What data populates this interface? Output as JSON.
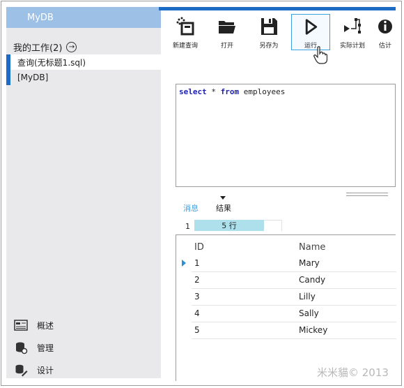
{
  "app": {
    "title": "MyDB"
  },
  "sidebar": {
    "section_label": "我的工作(2)",
    "items": [
      {
        "label": "查询(无标题1.sql)"
      },
      {
        "label": "[MyDB]"
      }
    ],
    "bottom_nav": [
      {
        "label": "概述",
        "icon": "overview-icon"
      },
      {
        "label": "管理",
        "icon": "database-admin-icon"
      },
      {
        "label": "设计",
        "icon": "design-icon"
      }
    ]
  },
  "toolbar": {
    "buttons": [
      {
        "label": "新建查询",
        "icon": "new-query-icon"
      },
      {
        "label": "打开",
        "icon": "open-folder-icon"
      },
      {
        "label": "另存为",
        "icon": "save-as-icon"
      },
      {
        "label": "运行",
        "icon": "run-icon",
        "selected": true
      },
      {
        "label": "实际计划",
        "icon": "actual-plan-icon"
      },
      {
        "label": "估计",
        "icon": "estimate-icon"
      }
    ]
  },
  "editor": {
    "tokens": [
      {
        "text": "select",
        "kw": true
      },
      {
        "text": " * ",
        "kw": false
      },
      {
        "text": "from",
        "kw": true
      },
      {
        "text": " employees",
        "kw": false
      }
    ]
  },
  "results": {
    "tabs": {
      "messages": "消息",
      "results": "结果"
    },
    "pager": {
      "page": "1",
      "rows_label": "5 行"
    },
    "columns": [
      "ID",
      "Name"
    ],
    "rows": [
      {
        "id": "1",
        "name": "Mary"
      },
      {
        "id": "2",
        "name": "Candy"
      },
      {
        "id": "3",
        "name": "Lilly"
      },
      {
        "id": "4",
        "name": "Sally"
      },
      {
        "id": "5",
        "name": "Mickey"
      }
    ]
  },
  "watermark": "米米貓© 2013",
  "colors": {
    "accent": "#1c6cc6",
    "brand_bg": "#9cc0e6",
    "sidebar_bg": "#e9e9eb",
    "keyword": "#1a20b8",
    "row_count_bg": "#aee0ec"
  }
}
